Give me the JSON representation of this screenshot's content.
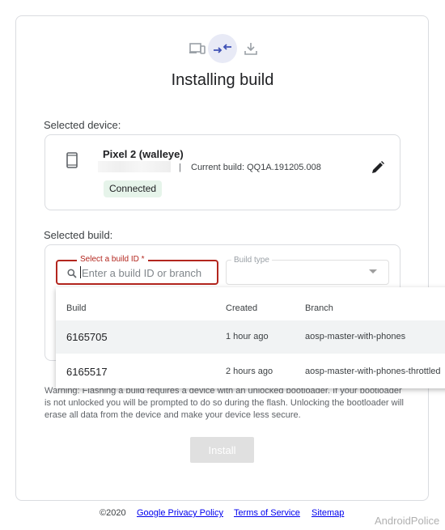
{
  "icons": {
    "step1": "devices-icon",
    "step2": "connecting-arrows-icon",
    "step3": "download-icon",
    "phone": "smartphone-icon",
    "edit": "pencil-edit-icon",
    "search": "search-icon",
    "dropdown": "dropdown-arrow-icon"
  },
  "colors": {
    "accent": "#3f51b5",
    "active_step_bg": "#e8eaf6",
    "error_outline": "#b3261e",
    "connected_bg": "#e6f4ea",
    "link": "#1a73e8"
  },
  "title": "Installing build",
  "device": {
    "section_label": "Selected device:",
    "name": "Pixel 2 (walleye)",
    "separator": "|",
    "current_build": "Current build: QQ1A.191205.008",
    "status": "Connected"
  },
  "build": {
    "section_label": "Selected build:",
    "id_label": "Select a build ID *",
    "id_placeholder": "Enter a build ID or branch",
    "id_value": "",
    "type_label": "Build type"
  },
  "builds_table": {
    "columns": [
      "Build",
      "Created",
      "Branch"
    ],
    "rows": [
      {
        "build": "6165705",
        "created": "1 hour ago",
        "branch": "aosp-master-with-phones"
      },
      {
        "build": "6165517",
        "created": "2 hours ago",
        "branch": "aosp-master-with-phones-throttled"
      }
    ]
  },
  "warning": "Warning: Flashing a build requires a device with an unlocked bootloader. If your bootloader is not unlocked you will be prompted to do so during the flash. Unlocking the bootloader will erase all data from the device and make your device less secure.",
  "install_label": "Install",
  "footer": {
    "copyright": "©2020",
    "privacy": "Google Privacy Policy",
    "terms": "Terms of Service",
    "sitemap": "Sitemap"
  },
  "watermark": "AndroidPolice"
}
